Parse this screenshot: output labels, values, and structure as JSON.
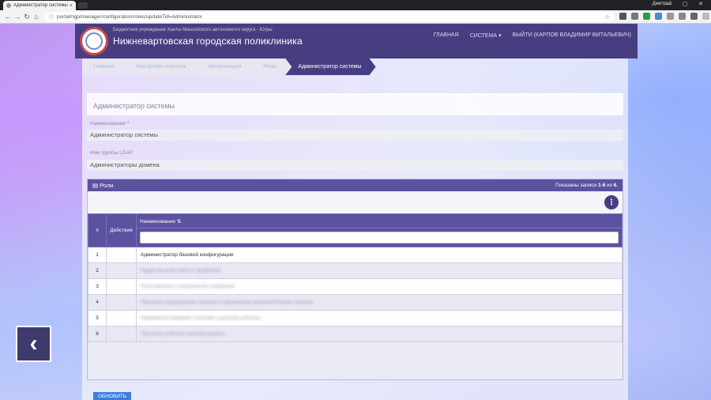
{
  "browser": {
    "tab_title": "Администратор системы",
    "tab_close": "×",
    "user": "Дмитрий",
    "url": "portal/ngp/manager/configuration/roles/updateTid=Administrator"
  },
  "header": {
    "subtitle": "Бюджетное учреждение Ханты-Мансийского автономного округа - Югры",
    "title": "Нижневартовская городская поликлиника",
    "nav": [
      "ГЛАВНАЯ",
      "СИСТЕМА ▾",
      "ВЫЙТИ (КАРПОВ ВЛАДИМИР ВИТАЛЬЕВИЧ)"
    ]
  },
  "breadcrumb": [
    "Главная",
    "Настройки портала",
    "Авторизация",
    "Роли",
    "Администратор системы"
  ],
  "page": {
    "heading": "Администратор системы",
    "name_label": "Наименование",
    "name_required": "*",
    "name_value": "Администратор системы",
    "ldap_label": "Имя группы LDAP",
    "ldap_value": "Администраторы домена"
  },
  "grid": {
    "title": "Роли",
    "info_prefix": "Показаны записи ",
    "info_range": "1-6",
    "info_of": " из ",
    "info_total": "6.",
    "columns": [
      "#",
      "Действия",
      "Наименование ⇅"
    ],
    "rows": [
      {
        "n": "1",
        "name": "Администратор базовой конфигурации",
        "blurred": false
      },
      {
        "n": "2",
        "name": "Редактор роли учёта и профилей",
        "blurred": true
      },
      {
        "n": "3",
        "name": "Пользователь и управление справками",
        "blurred": true
      },
      {
        "n": "4",
        "name": "Просмотр медицинских записей и параметров дополнительных записей",
        "blurred": true
      },
      {
        "n": "5",
        "name": "Управление правами и ролями и доступа учётных",
        "blurred": true
      },
      {
        "n": "6",
        "name": "Просмотр учётных записей данных",
        "blurred": true
      }
    ]
  },
  "refresh_label": "ОБНОВИТЬ",
  "back_arrow": "‹"
}
